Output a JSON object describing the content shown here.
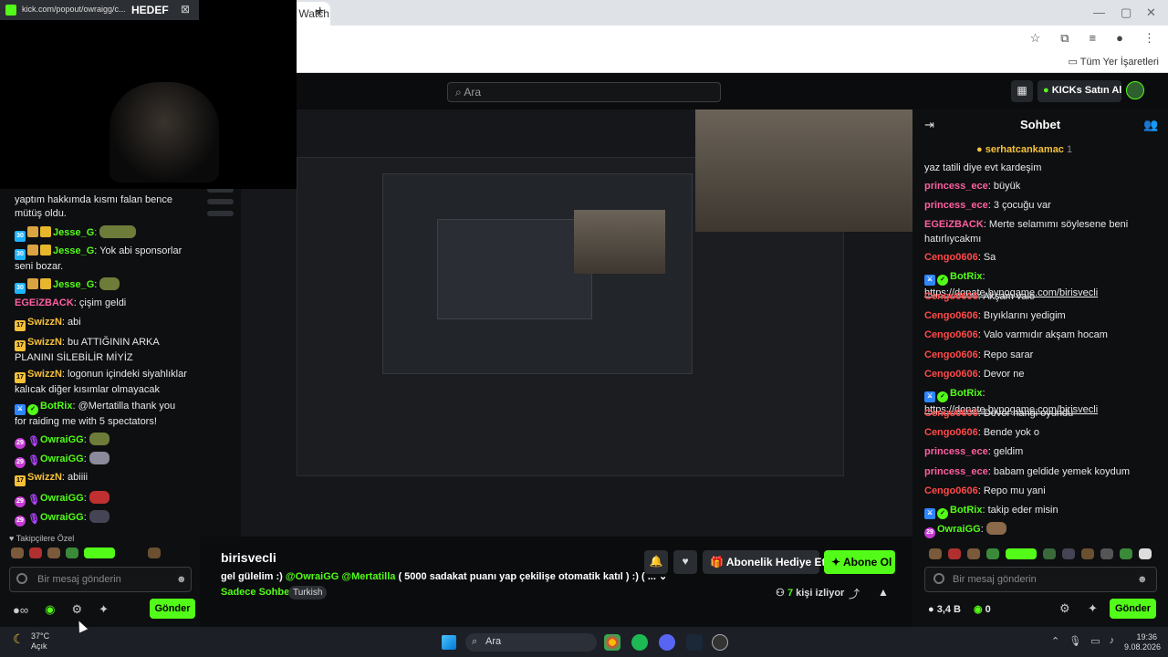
{
  "browser": {
    "tab_title": "isvecli Stream - Watch L",
    "popout_url": "kick.com/popout/owraigg/c...",
    "popout_title": "HEDEF",
    "bookmarks_label": "Tüm Yer İşaretleri",
    "search_placeholder": "Ara"
  },
  "kick": {
    "kicks_button": "KICKs Satın Al",
    "chat_title": "Sohbet",
    "pinned_user": "serhatcankamac",
    "pinned_count": "1"
  },
  "left_chat": {
    "messages": [
      {
        "text": "yaptım hakkımda kısmı falan bence mütüş oldu."
      },
      {
        "user": "Jesse_G",
        "text": ""
      },
      {
        "user": "Jesse_G",
        "text": "Yok abi sponsorlar seni bozar."
      },
      {
        "user": "Jesse_G",
        "text": ""
      },
      {
        "user": "EGEiZBACK",
        "text": "çişim geldi"
      },
      {
        "user": "SwizzN",
        "text": "abi"
      },
      {
        "user": "SwizzN",
        "text": "bu ATTIĞININ ARKA PLANINI SİLEBİLİR MİYİZ"
      },
      {
        "user": "SwizzN",
        "text": "logonun içindeki siyahlıklar kalıcak diğer kısımlar olmayacak"
      },
      {
        "user": "BotRix",
        "text": "@Mertatilla thank you for raiding me with 5 spectators!"
      },
      {
        "user": "OwraiGG",
        "text": ""
      },
      {
        "user": "OwraiGG",
        "text": ""
      },
      {
        "user": "SwizzN",
        "text": "abiiii"
      },
      {
        "user": "OwraiGG",
        "text": ""
      },
      {
        "user": "OwraiGG",
        "text": ""
      }
    ],
    "followers_only": "Takipçilere Özel",
    "input_placeholder": "Bir mesaj gönderin",
    "send_label": "Gönder"
  },
  "right_chat": {
    "messages": [
      {
        "user": "",
        "text": "yaz tatili diye evt kardeşim"
      },
      {
        "user": "princess_ece",
        "text": "büyük"
      },
      {
        "user": "princess_ece",
        "text": "3 çocuğu var"
      },
      {
        "user": "EGEiZBACK",
        "text": "Merte selamımı söylesene beni hatırlıycakmı"
      },
      {
        "user": "Cengo0606",
        "text": "Sa"
      },
      {
        "user": "BotRix",
        "text": "",
        "link": "https://donate.bynogame.com/birisvecli"
      },
      {
        "user": "Cengo0606",
        "text": "Akşam valo"
      },
      {
        "user": "Cengo0606",
        "text": "Bıyıklarını yedigim"
      },
      {
        "user": "Cengo0606",
        "text": "Valo varmıdır akşam hocam"
      },
      {
        "user": "Cengo0606",
        "text": "Repo sarar"
      },
      {
        "user": "Cengo0606",
        "text": "Devor ne"
      },
      {
        "user": "BotRix",
        "text": "",
        "link": "https://donate.bynogame.com/birisvecli"
      },
      {
        "user": "Cengo0606",
        "text": "Devor hangi oyundu"
      },
      {
        "user": "Cengo0606",
        "text": "Bende yok o"
      },
      {
        "user": "princess_ece",
        "text": "geldim"
      },
      {
        "user": "princess_ece",
        "text": "babam geldide yemek koydum"
      },
      {
        "user": "Cengo0606",
        "text": "Repo mu yani"
      },
      {
        "user": "BotRix",
        "text": "takip eder misin"
      },
      {
        "user": "OwraiGG",
        "text": ""
      }
    ],
    "input_placeholder": "Bir mesaj gönderin",
    "kicks_balance": "3,4 B",
    "points": "0",
    "send_label": "Gönder"
  },
  "stream": {
    "channel": "birisvecli",
    "title_prefix": "gel gülelim :)",
    "mentions": "@OwraiGG @Mertatilla",
    "title_suffix": "( 5000 sadakat puanı yap çekilişe otomatik katıl ) :) ( ...",
    "category": "Sadece Sohbet",
    "tag": "Turkish",
    "gift_label": "Abonelik Hediye Et",
    "subscribe_label": "Abone Ol",
    "viewers_count": "7",
    "viewers_label": "kişi izliyor"
  },
  "taskbar": {
    "temperature": "37°C",
    "weather": "Açık",
    "search": "Ara",
    "time": "19:36",
    "date": "9.08.2026"
  },
  "colors": {
    "kick_green": "#53fc18",
    "username_red": "#ff4a4a",
    "username_pink": "#ff5fa2",
    "username_green": "#53fc18",
    "username_yellow": "#f6c13a"
  }
}
